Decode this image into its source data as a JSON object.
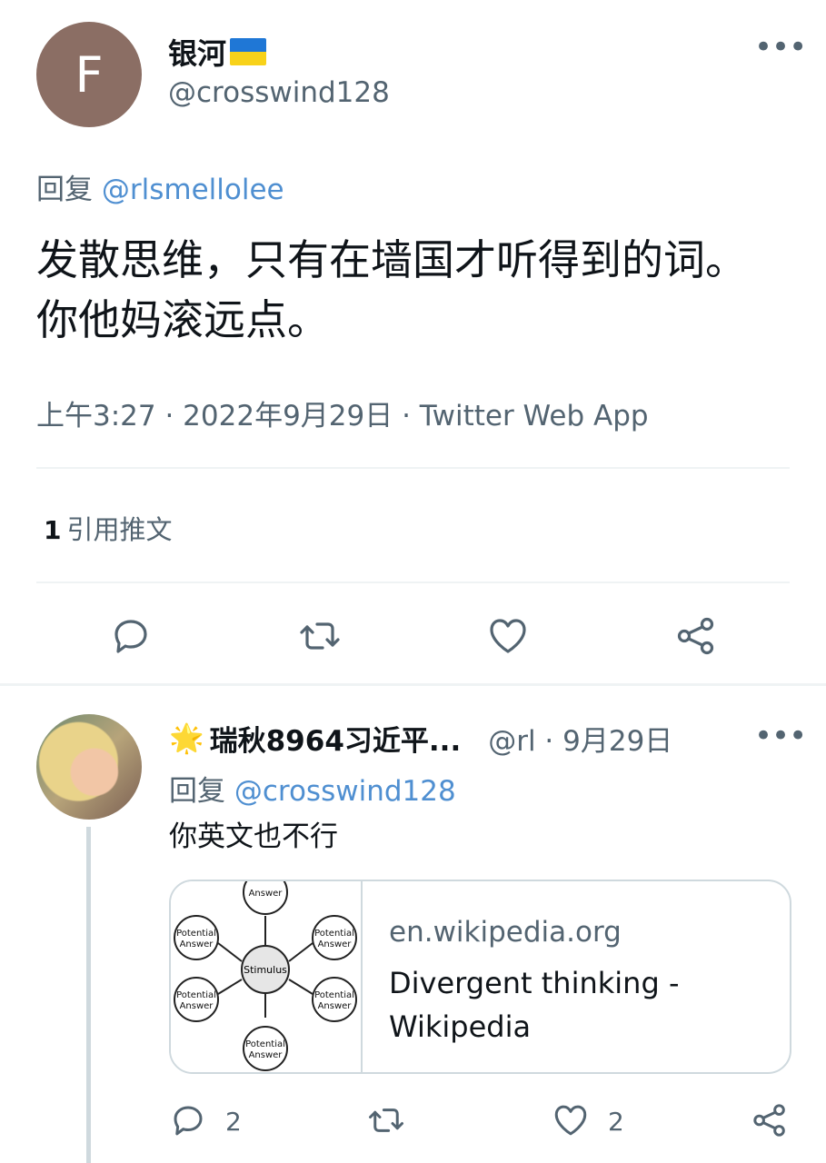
{
  "main_tweet": {
    "avatar_letter": "F",
    "display_name": "银河",
    "handle": "@crosswind128",
    "reply_prefix": "回复",
    "reply_to": "@rlsmellolee",
    "text": "发散思维，只有在墙国才听得到的词。你他妈滚远点。",
    "timestamp": "上午3:27 · 2022年9月29日 · Twitter Web App",
    "quote_count": "1",
    "quote_label": "引用推文"
  },
  "reply_tweet": {
    "emoji": "🌟",
    "display_name": "瑞秋8964习近平...",
    "meta": "@rl · 9月29日",
    "reply_prefix": "回复",
    "reply_to": "@crosswind128",
    "text": "你英文也不行",
    "card": {
      "domain": "en.wikipedia.org",
      "title": "Divergent thinking - Wikipedia",
      "diagram_center": "Stimulus",
      "diagram_node": "Potential Answer"
    },
    "reply_count": "2",
    "like_count": "2"
  },
  "icons": {
    "more": "more-icon",
    "reply": "reply-icon",
    "retweet": "retweet-icon",
    "like": "like-icon",
    "share": "share-icon"
  },
  "colors": {
    "link": "#4f8fd1",
    "secondary_text": "#536471",
    "divider": "#eff3f4",
    "avatar_bg": "#8b6e64"
  }
}
